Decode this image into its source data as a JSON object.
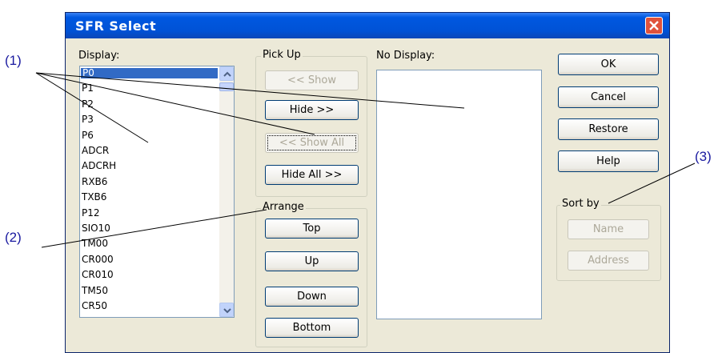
{
  "callouts": {
    "c1": "(1)",
    "c2": "(2)",
    "c3": "(3)"
  },
  "window": {
    "title": "SFR Select"
  },
  "display": {
    "label": "Display:",
    "items": [
      "P0",
      "P1",
      "P2",
      "P3",
      "P6",
      "ADCR",
      "ADCRH",
      "RXB6",
      "TXB6",
      "P12",
      "SIO10",
      "TM00",
      "CR000",
      "CR010",
      "TM50",
      "CR50"
    ],
    "selected_index": 0
  },
  "pickup": {
    "label": "Pick Up",
    "show": "<< Show",
    "hide": "Hide >>",
    "show_all": "<< Show All",
    "hide_all": "Hide All >>"
  },
  "arrange": {
    "label": "Arrange",
    "top": "Top",
    "up": "Up",
    "down": "Down",
    "bottom": "Bottom"
  },
  "nodisplay": {
    "label": "No Display:",
    "items": []
  },
  "actions": {
    "ok": "OK",
    "cancel": "Cancel",
    "restore": "Restore",
    "help": "Help"
  },
  "sortby": {
    "label": "Sort by",
    "name": "Name",
    "address": "Address"
  },
  "colors": {
    "title_bar": "#0058e0",
    "dialog_bg": "#ece9d8",
    "selection": "#316ac5",
    "close_button": "#e0523b",
    "callout": "#1a1aa0"
  }
}
